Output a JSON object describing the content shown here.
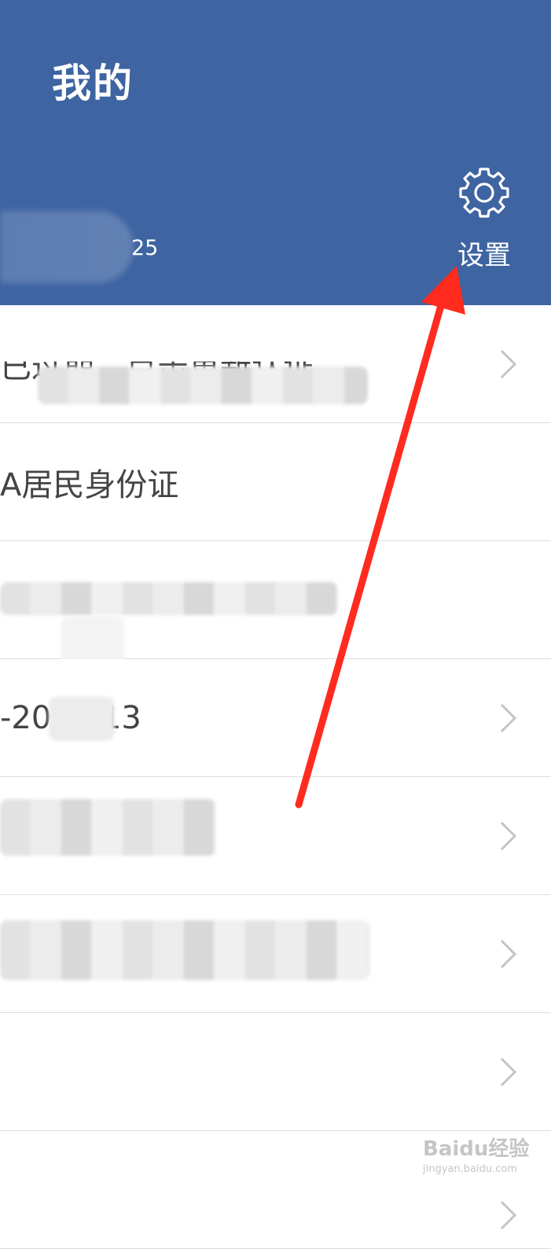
{
  "header": {
    "title": "我的",
    "user_suffix": "25",
    "settings_label": "设置"
  },
  "list": {
    "rows": [
      {
        "text": "已过期，点击重新认证",
        "has_chevron": true
      },
      {
        "text": "A居民身份证",
        "has_chevron": false
      },
      {
        "text": "",
        "has_chevron": false
      },
      {
        "text": "-2017.13",
        "has_chevron": true
      },
      {
        "text": "",
        "has_chevron": true
      },
      {
        "text": "",
        "has_chevron": true
      },
      {
        "text": "",
        "has_chevron": true
      },
      {
        "text": "",
        "has_chevron": true
      }
    ]
  },
  "watermark": {
    "main": "Baidu经验",
    "sub": "jingyan.baidu.com"
  },
  "colors": {
    "header_bg": "#3e64a2",
    "arrow": "#ff2b1e",
    "divider": "#dcdcdc",
    "chevron": "#c4c4c4"
  },
  "icons": {
    "settings": "gear-icon",
    "row_action": "chevron-right-icon"
  }
}
